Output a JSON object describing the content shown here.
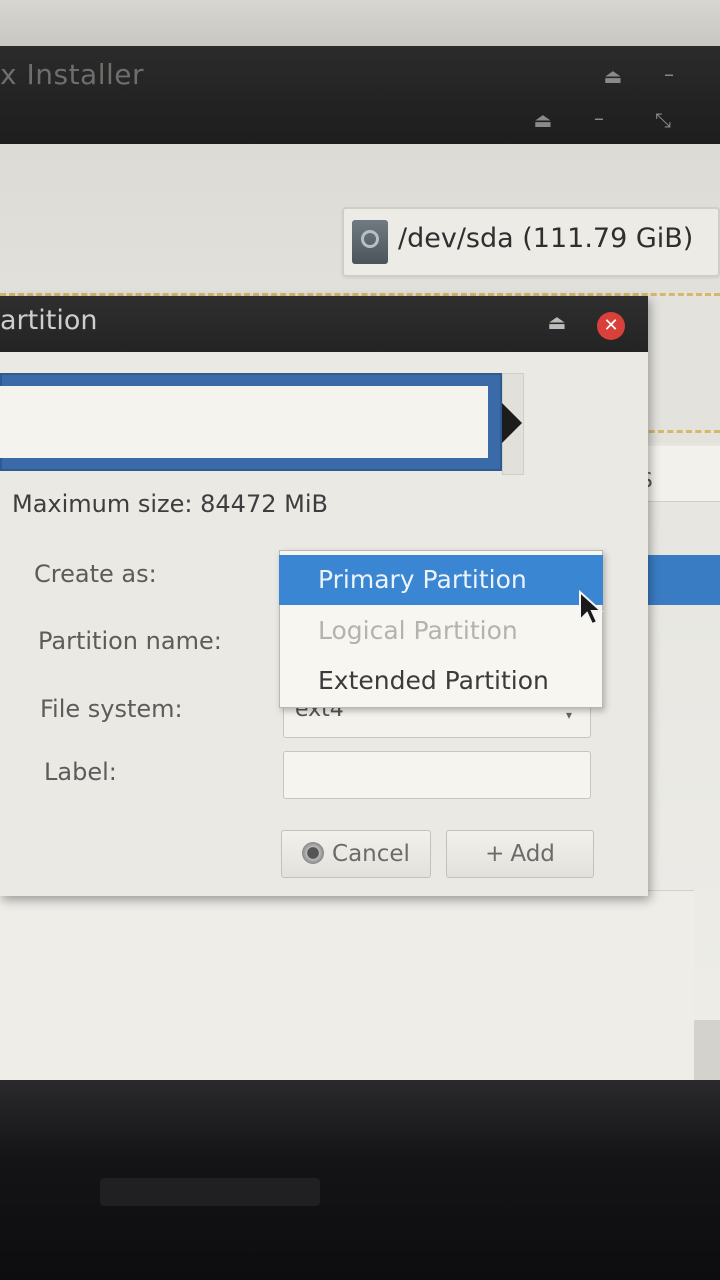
{
  "window": {
    "title": "x Installer",
    "eject_symbol": "⏏",
    "minimize_symbol": "–",
    "restore_symbol": "⤡"
  },
  "device": {
    "label": "/dev/sda  (111.79 GiB)",
    "icon": "disk-icon"
  },
  "table": {
    "header_fragment": "S"
  },
  "dialog": {
    "title": "artition",
    "eject_symbol": "⏏",
    "close_symbol": "✕",
    "max_size_text": "Maximum size: 84472 MiB",
    "create_as_label": "Create as:",
    "partition_name_label": "Partition name:",
    "file_system_label": "File system:",
    "file_system_value": "ext4",
    "label_label": "Label:",
    "label_value": "",
    "cancel_label": "Cancel",
    "add_label": "Add",
    "add_icon_glyph": "+"
  },
  "dropdown": {
    "options": [
      {
        "label": "Primary Partition",
        "state": "highlighted"
      },
      {
        "label": "Logical Partition",
        "state": "disabled"
      },
      {
        "label": "Extended Partition",
        "state": "normal"
      }
    ]
  },
  "colors": {
    "highlight": "#3a86d2",
    "titlebar": "#1d1d1e",
    "close_button": "#d9403a",
    "slider_border": "#3a6aa8"
  }
}
